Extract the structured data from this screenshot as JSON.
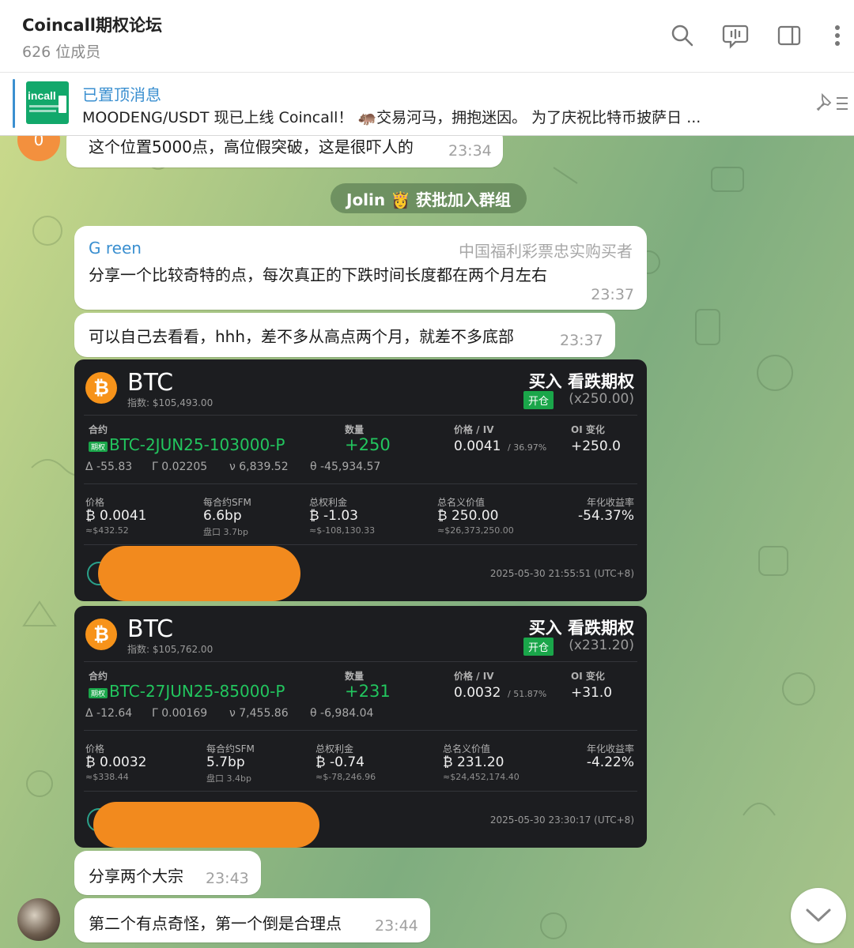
{
  "header": {
    "title": "Coincall期权论坛",
    "members": "626 位成员",
    "icons": [
      "search-icon",
      "voice-chat-icon",
      "sidebar-icon",
      "more-icon"
    ]
  },
  "pinned": {
    "label": "已置顶消息",
    "thumb_text": "incall",
    "text": "MOODENG/USDT 现已上线 Coincall！ 🦛交易河马，拥抱迷因。 为了庆祝比特币披萨日 ..."
  },
  "messages": {
    "m1": {
      "avatar_text": "0",
      "text": "这个位置5000点，高位假突破，这是很吓人的",
      "time": "23:34"
    },
    "service": {
      "text": "Jolin 👸 获批加入群组"
    },
    "m2": {
      "sender": "G reen",
      "rank": "中国福利彩票忠实购买者",
      "text": "分享一个比较奇特的点，每次真正的下跌时间长度都在两个月左右",
      "time": "23:37"
    },
    "m3": {
      "text": "可以自己去看看，hhh，差不多从高点两个月，就差不多底部",
      "time": "23:37"
    },
    "m4": {
      "text": "分享两个大宗",
      "time": "23:43"
    },
    "m5": {
      "text": "第二个有点奇怪，第一个倒是合理点",
      "time": "23:44"
    }
  },
  "cards": [
    {
      "symbol": "BTC",
      "index": "指数: $105,493.00",
      "action": "买入 看跌期权",
      "open": "开仓",
      "multiplier": "(x250.00)",
      "labels": {
        "contract": "合约",
        "qty": "数量",
        "price_iv": "价格 / IV",
        "oi": "OI 变化",
        "price": "价格",
        "sfm": "每合约SFM",
        "premium": "总权利金",
        "notional": "总名义价值",
        "yield": "年化收益率"
      },
      "tag": "期权",
      "contract": "BTC-2JUN25-103000-P",
      "qty": "+250",
      "price_iv": "0.0041",
      "iv": "/ 36.97%",
      "oi": "+250.0",
      "delta": "Δ -55.83",
      "gamma": "Γ 0.02205",
      "vega": "ν 6,839.52",
      "theta": "θ -45,934.57",
      "price": "₿ 0.0041",
      "price_usd": "≈$432.52",
      "sfm": "6.6bp",
      "sfm_sub": "盘口 3.7bp",
      "premium": "₿ -1.03",
      "premium_usd": "≈$-108,130.33",
      "notional": "₿ 250.00",
      "notional_usd": "≈$26,373,250.00",
      "yield": "-54.37%",
      "timestamp": "2025-05-30 21:55:51 (UTC+8)"
    },
    {
      "symbol": "BTC",
      "index": "指数: $105,762.00",
      "action": "买入 看跌期权",
      "open": "开仓",
      "multiplier": "(x231.20)",
      "labels": {
        "contract": "合约",
        "qty": "数量",
        "price_iv": "价格 / IV",
        "oi": "OI 变化",
        "price": "价格",
        "sfm": "每合约SFM",
        "premium": "总权利金",
        "notional": "总名义价值",
        "yield": "年化收益率"
      },
      "tag": "期权",
      "contract": "BTC-27JUN25-85000-P",
      "qty": "+231",
      "price_iv": "0.0032",
      "iv": "/ 51.87%",
      "oi": "+31.0",
      "delta": "Δ -12.64",
      "gamma": "Γ 0.00169",
      "vega": "ν 7,455.86",
      "theta": "θ -6,984.04",
      "price": "₿ 0.0032",
      "price_usd": "≈$338.44",
      "sfm": "5.7bp",
      "sfm_sub": "盘口 3.4bp",
      "premium": "₿ -0.74",
      "premium_usd": "≈$-78,246.96",
      "notional": "₿ 231.20",
      "notional_usd": "≈$24,452,174.40",
      "yield": "-4.22%",
      "timestamp": "2025-05-30 23:30:17 (UTC+8)"
    }
  ],
  "colors": {
    "accent": "#3a8fd0",
    "green": "#22c55e",
    "card_bg": "#1c1d20",
    "redaction": "#f28a1e"
  }
}
